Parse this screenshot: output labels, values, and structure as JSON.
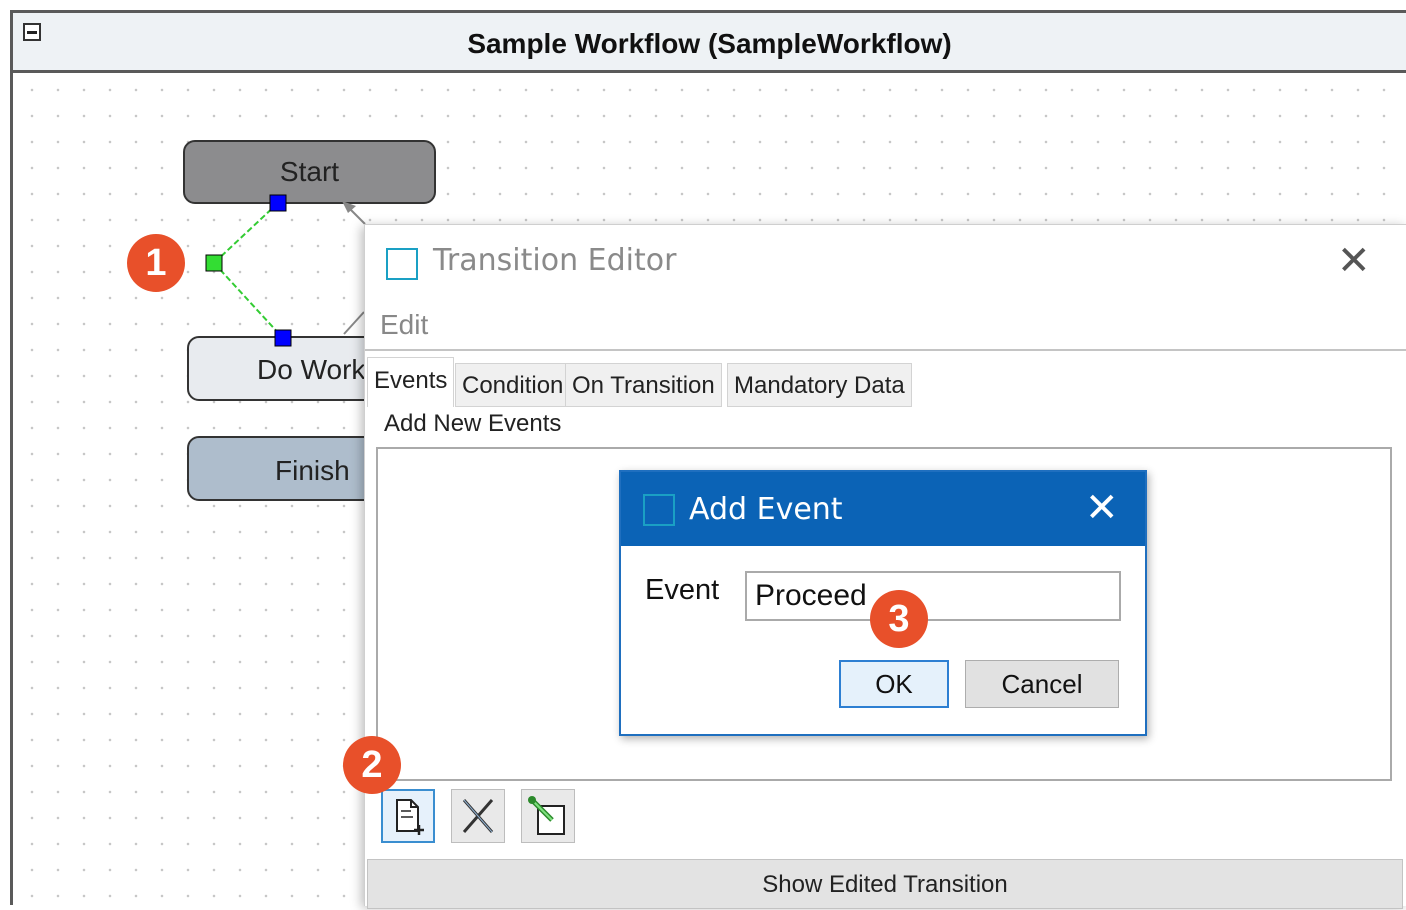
{
  "workflow": {
    "title": "Sample Workflow (SampleWorkflow)",
    "nodes": {
      "start": "Start",
      "do_work": "Do Work",
      "finish": "Finish"
    }
  },
  "callouts": [
    "1",
    "2",
    "3"
  ],
  "transition_editor": {
    "title": "Transition Editor",
    "menu": [
      "Edit"
    ],
    "tabs": [
      "Events",
      "Condition",
      "On Transition",
      "Mandatory Data"
    ],
    "active_tab": "Events",
    "section_label": "Add New Events",
    "toolbar_icons": [
      "new-event-icon",
      "delete-event-icon",
      "edit-event-icon"
    ],
    "footer_button": "Show Edited Transition"
  },
  "add_event_dialog": {
    "title": "Add Event",
    "field_label": "Event",
    "field_value": "Proceed",
    "ok_label": "OK",
    "cancel_label": "Cancel"
  },
  "colors": {
    "dialog_title_bar": "#0b63b6",
    "callout": "#e8502a",
    "start_node": "#8c8c8e",
    "finish_node": "#aebdcc",
    "handle_blue": "#0000ff",
    "handle_green": "#33dd33"
  }
}
